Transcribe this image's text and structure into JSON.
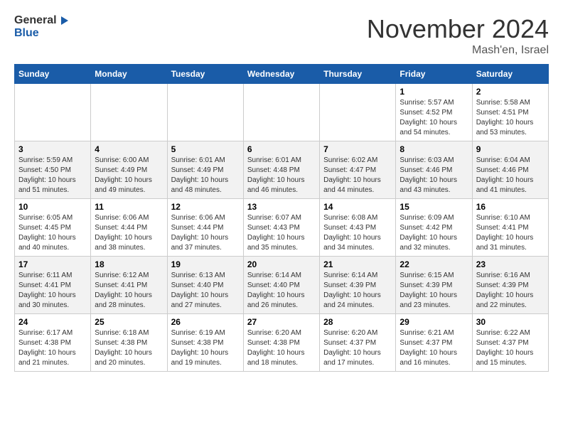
{
  "header": {
    "logo_general": "General",
    "logo_blue": "Blue",
    "month": "November 2024",
    "location": "Mash'en, Israel"
  },
  "weekdays": [
    "Sunday",
    "Monday",
    "Tuesday",
    "Wednesday",
    "Thursday",
    "Friday",
    "Saturday"
  ],
  "weeks": [
    [
      null,
      null,
      null,
      null,
      null,
      {
        "day": "1",
        "sunrise": "5:57 AM",
        "sunset": "4:52 PM",
        "daylight": "10 hours and 54 minutes."
      },
      {
        "day": "2",
        "sunrise": "5:58 AM",
        "sunset": "4:51 PM",
        "daylight": "10 hours and 53 minutes."
      }
    ],
    [
      {
        "day": "3",
        "sunrise": "5:59 AM",
        "sunset": "4:50 PM",
        "daylight": "10 hours and 51 minutes."
      },
      {
        "day": "4",
        "sunrise": "6:00 AM",
        "sunset": "4:49 PM",
        "daylight": "10 hours and 49 minutes."
      },
      {
        "day": "5",
        "sunrise": "6:01 AM",
        "sunset": "4:49 PM",
        "daylight": "10 hours and 48 minutes."
      },
      {
        "day": "6",
        "sunrise": "6:01 AM",
        "sunset": "4:48 PM",
        "daylight": "10 hours and 46 minutes."
      },
      {
        "day": "7",
        "sunrise": "6:02 AM",
        "sunset": "4:47 PM",
        "daylight": "10 hours and 44 minutes."
      },
      {
        "day": "8",
        "sunrise": "6:03 AM",
        "sunset": "4:46 PM",
        "daylight": "10 hours and 43 minutes."
      },
      {
        "day": "9",
        "sunrise": "6:04 AM",
        "sunset": "4:46 PM",
        "daylight": "10 hours and 41 minutes."
      }
    ],
    [
      {
        "day": "10",
        "sunrise": "6:05 AM",
        "sunset": "4:45 PM",
        "daylight": "10 hours and 40 minutes."
      },
      {
        "day": "11",
        "sunrise": "6:06 AM",
        "sunset": "4:44 PM",
        "daylight": "10 hours and 38 minutes."
      },
      {
        "day": "12",
        "sunrise": "6:06 AM",
        "sunset": "4:44 PM",
        "daylight": "10 hours and 37 minutes."
      },
      {
        "day": "13",
        "sunrise": "6:07 AM",
        "sunset": "4:43 PM",
        "daylight": "10 hours and 35 minutes."
      },
      {
        "day": "14",
        "sunrise": "6:08 AM",
        "sunset": "4:43 PM",
        "daylight": "10 hours and 34 minutes."
      },
      {
        "day": "15",
        "sunrise": "6:09 AM",
        "sunset": "4:42 PM",
        "daylight": "10 hours and 32 minutes."
      },
      {
        "day": "16",
        "sunrise": "6:10 AM",
        "sunset": "4:41 PM",
        "daylight": "10 hours and 31 minutes."
      }
    ],
    [
      {
        "day": "17",
        "sunrise": "6:11 AM",
        "sunset": "4:41 PM",
        "daylight": "10 hours and 30 minutes."
      },
      {
        "day": "18",
        "sunrise": "6:12 AM",
        "sunset": "4:41 PM",
        "daylight": "10 hours and 28 minutes."
      },
      {
        "day": "19",
        "sunrise": "6:13 AM",
        "sunset": "4:40 PM",
        "daylight": "10 hours and 27 minutes."
      },
      {
        "day": "20",
        "sunrise": "6:14 AM",
        "sunset": "4:40 PM",
        "daylight": "10 hours and 26 minutes."
      },
      {
        "day": "21",
        "sunrise": "6:14 AM",
        "sunset": "4:39 PM",
        "daylight": "10 hours and 24 minutes."
      },
      {
        "day": "22",
        "sunrise": "6:15 AM",
        "sunset": "4:39 PM",
        "daylight": "10 hours and 23 minutes."
      },
      {
        "day": "23",
        "sunrise": "6:16 AM",
        "sunset": "4:39 PM",
        "daylight": "10 hours and 22 minutes."
      }
    ],
    [
      {
        "day": "24",
        "sunrise": "6:17 AM",
        "sunset": "4:38 PM",
        "daylight": "10 hours and 21 minutes."
      },
      {
        "day": "25",
        "sunrise": "6:18 AM",
        "sunset": "4:38 PM",
        "daylight": "10 hours and 20 minutes."
      },
      {
        "day": "26",
        "sunrise": "6:19 AM",
        "sunset": "4:38 PM",
        "daylight": "10 hours and 19 minutes."
      },
      {
        "day": "27",
        "sunrise": "6:20 AM",
        "sunset": "4:38 PM",
        "daylight": "10 hours and 18 minutes."
      },
      {
        "day": "28",
        "sunrise": "6:20 AM",
        "sunset": "4:37 PM",
        "daylight": "10 hours and 17 minutes."
      },
      {
        "day": "29",
        "sunrise": "6:21 AM",
        "sunset": "4:37 PM",
        "daylight": "10 hours and 16 minutes."
      },
      {
        "day": "30",
        "sunrise": "6:22 AM",
        "sunset": "4:37 PM",
        "daylight": "10 hours and 15 minutes."
      }
    ]
  ],
  "labels": {
    "sunrise": "Sunrise:",
    "sunset": "Sunset:",
    "daylight": "Daylight:"
  }
}
